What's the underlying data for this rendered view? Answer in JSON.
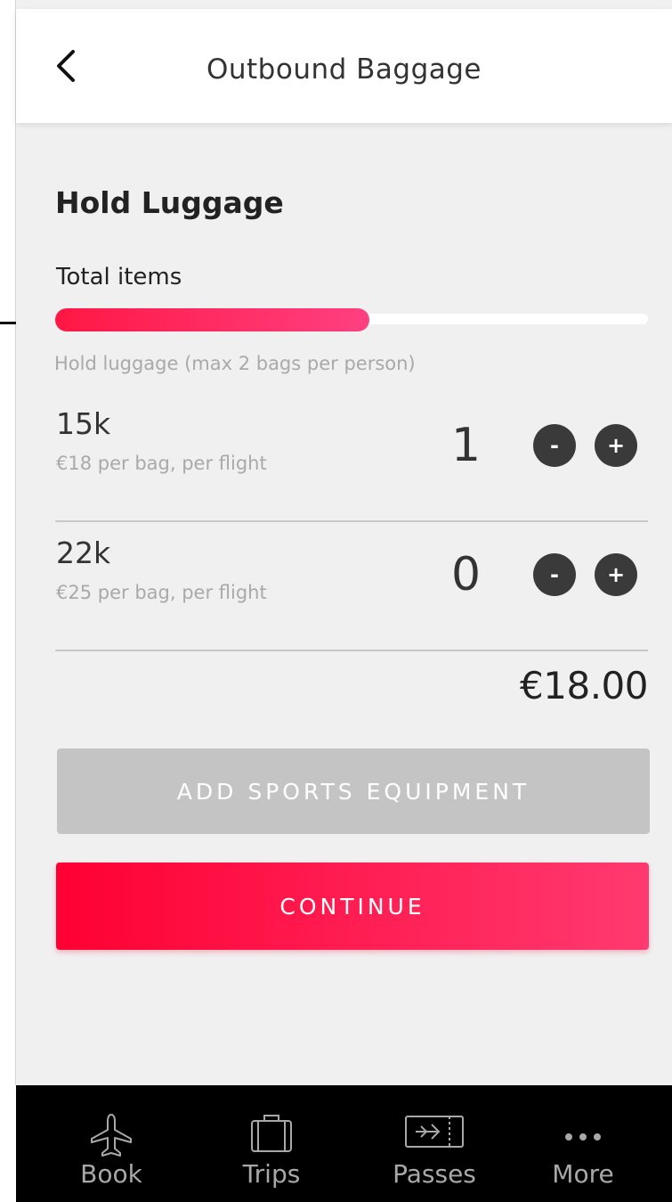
{
  "header": {
    "title": "Outbound Baggage"
  },
  "hold_luggage": {
    "section_title": "Hold Luggage",
    "total_items_label": "Total items",
    "progress_fraction": 0.53,
    "hint": "Hold luggage (max 2 bags per person)",
    "options": [
      {
        "weight": "15k",
        "price": "€18 per bag, per flight",
        "quantity": "1",
        "minus": "-",
        "plus": "+"
      },
      {
        "weight": "22k",
        "price": "€25 per bag, per flight",
        "quantity": "0",
        "minus": "-",
        "plus": "+"
      }
    ],
    "total": "€18.00"
  },
  "buttons": {
    "sports": "ADD SPORTS EQUIPMENT",
    "continue": "CONTINUE"
  },
  "tabbar": {
    "items": [
      {
        "label": "Book",
        "icon": "airplane-icon"
      },
      {
        "label": "Trips",
        "icon": "suitcase-icon"
      },
      {
        "label": "Passes",
        "icon": "boarding-pass-icon"
      },
      {
        "label": "More",
        "icon": "more-dots-icon"
      }
    ]
  },
  "colors": {
    "accent_start": "#ff0033",
    "accent_end": "#ff3a70",
    "tabbar_bg": "#000000",
    "disabled_button": "#c4c4c4"
  }
}
